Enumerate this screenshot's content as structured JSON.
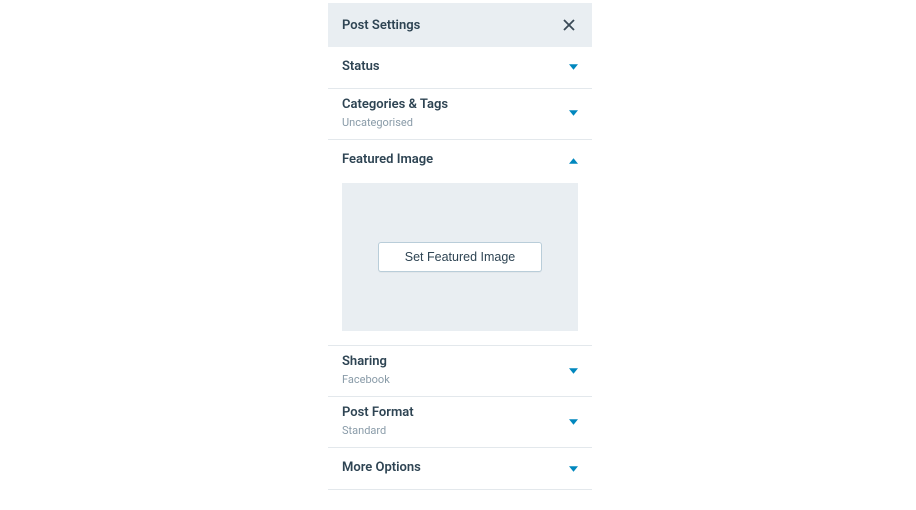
{
  "header": {
    "title": "Post Settings"
  },
  "sections": {
    "status": {
      "title": "Status"
    },
    "categories": {
      "title": "Categories & Tags",
      "sub": "Uncategorised"
    },
    "featured": {
      "title": "Featured Image",
      "button": "Set Featured Image"
    },
    "sharing": {
      "title": "Sharing",
      "sub": "Facebook"
    },
    "postformat": {
      "title": "Post Format",
      "sub": "Standard"
    },
    "more": {
      "title": "More Options"
    }
  }
}
